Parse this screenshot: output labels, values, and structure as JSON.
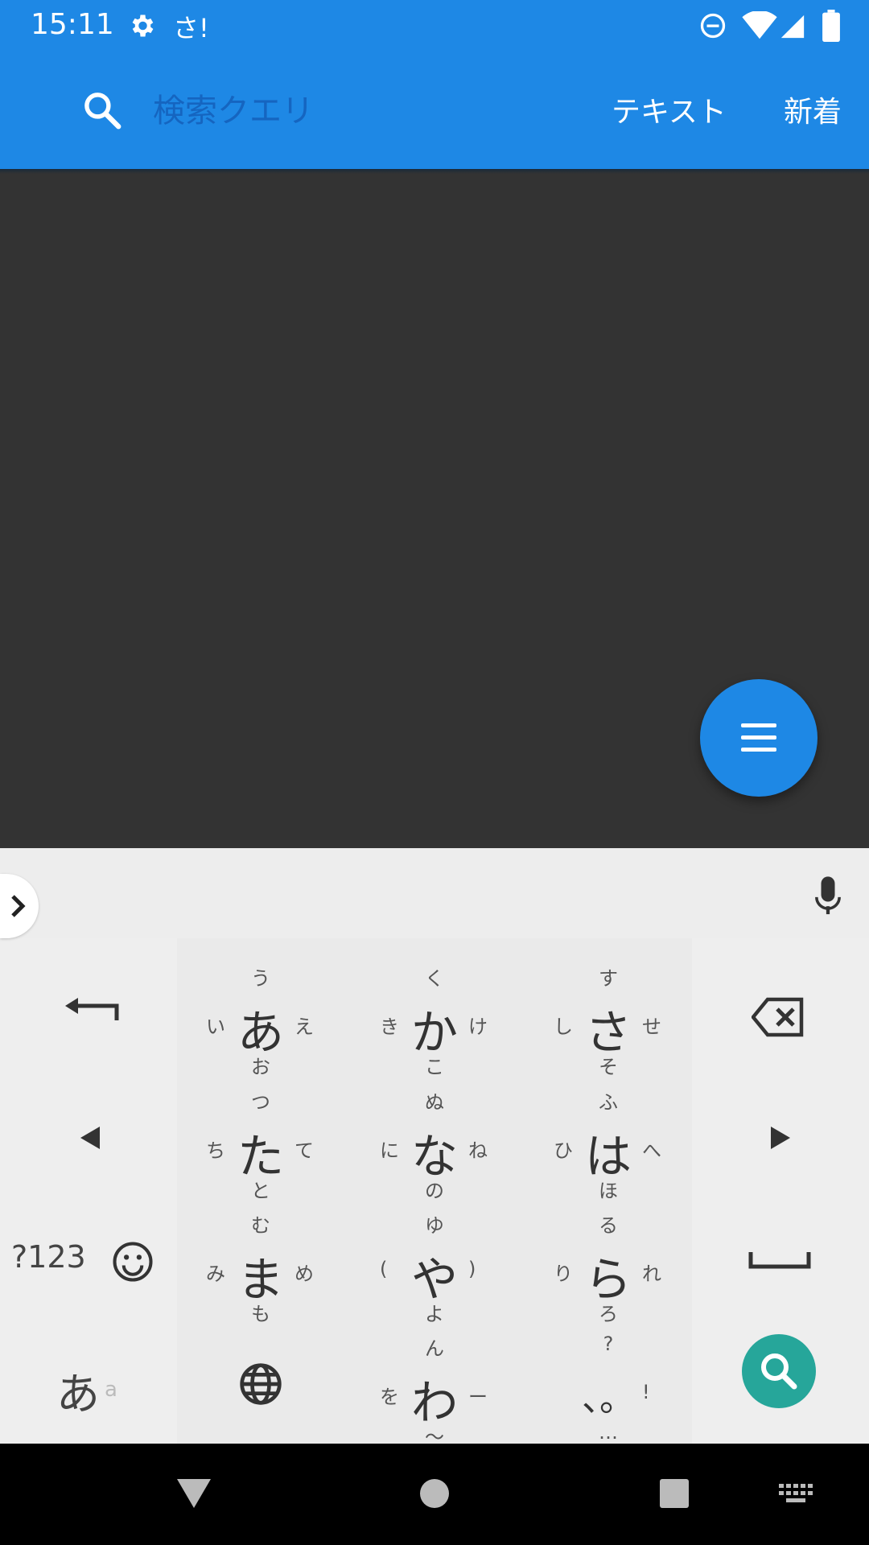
{
  "status_bar": {
    "time": "15:11",
    "notification_text": "さ!"
  },
  "app_bar": {
    "search_placeholder": "検索クエリ",
    "actions": [
      "テキスト",
      "新着"
    ]
  },
  "colors": {
    "primary": "#1E88E5",
    "content_bg": "#333333",
    "keyboard_bg": "#EEEEEE",
    "search_key": "#26A69A"
  },
  "keyboard": {
    "mode_key": "?123",
    "lang_key": "あ",
    "lang_key_small": "a",
    "kana_keys": [
      {
        "main": "あ",
        "up": "う",
        "down": "お",
        "left": "い",
        "right": "え"
      },
      {
        "main": "か",
        "up": "く",
        "down": "こ",
        "left": "き",
        "right": "け"
      },
      {
        "main": "さ",
        "up": "す",
        "down": "そ",
        "left": "し",
        "right": "せ"
      },
      {
        "main": "た",
        "up": "つ",
        "down": "と",
        "left": "ち",
        "right": "て"
      },
      {
        "main": "な",
        "up": "ぬ",
        "down": "の",
        "left": "に",
        "right": "ね"
      },
      {
        "main": "は",
        "up": "ふ",
        "down": "ほ",
        "left": "ひ",
        "right": "へ"
      },
      {
        "main": "ま",
        "up": "む",
        "down": "も",
        "left": "み",
        "right": "め"
      },
      {
        "main": "や",
        "up": "ゆ",
        "down": "よ",
        "left": "(",
        "right": ")"
      },
      {
        "main": "ら",
        "up": "る",
        "down": "ろ",
        "left": "り",
        "right": "れ"
      },
      {
        "main": "わ",
        "up": "ん",
        "down": "〜",
        "left": "を",
        "right": "ー"
      },
      {
        "main": "、。",
        "up": "?",
        "down": "…",
        "left": "",
        "right": "!"
      }
    ]
  },
  "icons": [
    "gear-icon",
    "dnd-icon",
    "wifi-icon",
    "signal-icon",
    "battery-icon",
    "search-icon",
    "menu-icon",
    "chevron-right-icon",
    "mic-icon",
    "enter-icon",
    "backspace-icon",
    "arrow-left-icon",
    "arrow-right-icon",
    "emoji-icon",
    "space-icon",
    "globe-icon",
    "back-icon",
    "home-icon",
    "recents-icon",
    "keyboard-icon"
  ]
}
